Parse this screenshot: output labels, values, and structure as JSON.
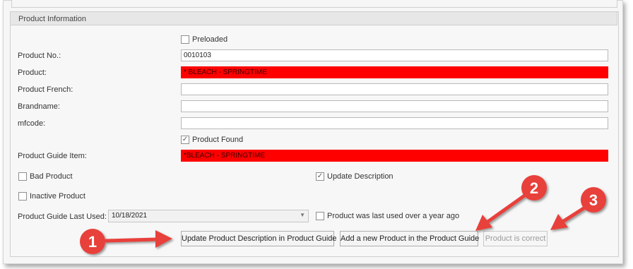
{
  "section": {
    "title": "Product Information"
  },
  "checkboxes": {
    "preloaded": {
      "label": "Preloaded",
      "checked": false
    },
    "product_found": {
      "label": "Product Found",
      "checked": true
    },
    "bad_product": {
      "label": "Bad Product",
      "checked": false
    },
    "update_description": {
      "label": "Update Description",
      "checked": true
    },
    "inactive_product": {
      "label": "Inactive Product",
      "checked": false
    },
    "last_used_over_year": {
      "label": "Product was last used over a year ago",
      "checked": false
    }
  },
  "fields": {
    "product_no": {
      "label": "Product No.:",
      "value": "0010103"
    },
    "product": {
      "label": "Product:",
      "value": "* BLEACH - SPRINGTIME"
    },
    "product_french": {
      "label": "Product French:",
      "value": ""
    },
    "brandname": {
      "label": "Brandname:",
      "value": ""
    },
    "mfcode": {
      "label": "mfcode:",
      "value": ""
    },
    "product_guide_item": {
      "label": "Product Guide Item:",
      "value": "*BLEACH - SPRINGTIME"
    },
    "last_used": {
      "label": "Product Guide Last Used:",
      "value": "10/18/2021"
    }
  },
  "buttons": {
    "update_description": "Update Product Description in Product Guide",
    "add_new": "Add a new Product in the Product Guide",
    "correct": "Product is correct"
  },
  "annotations": {
    "color": "#e8413b",
    "markers": [
      "1",
      "2",
      "3"
    ]
  },
  "icons": {
    "check": "✓",
    "dropdown": "▼"
  }
}
